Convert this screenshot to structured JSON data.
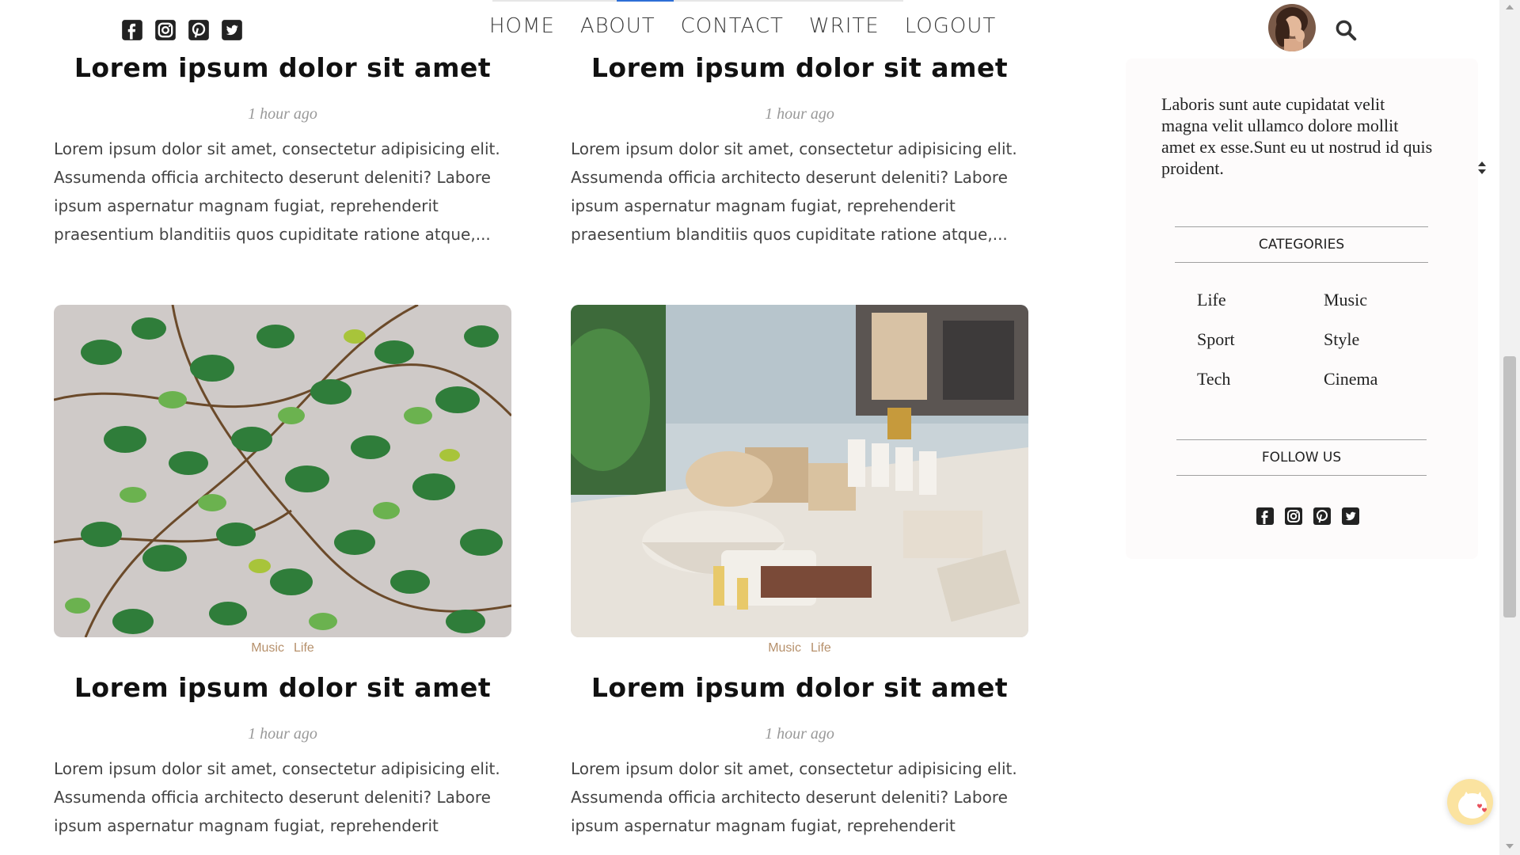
{
  "nav": {
    "links": [
      "HOME",
      "ABOUT",
      "CONTACT",
      "WRITE",
      "LOGOUT"
    ],
    "progress_fraction": 0.14,
    "social_icons": [
      "facebook-icon",
      "instagram-icon",
      "pinterest-icon",
      "twitter-icon"
    ]
  },
  "posts": [
    {
      "title": "Lorem ipsum dolor sit amet",
      "date": "1 hour ago",
      "desc": "Lorem ipsum dolor sit amet, consectetur adipisicing elit. Assumenda officia architecto deserunt deleniti? Labore ipsum aspernatur magnam fugiat, reprehenderit praesentium blanditiis quos cupiditate ratione atque,..."
    },
    {
      "title": "Lorem ipsum dolor sit amet",
      "date": "1 hour ago",
      "desc": "Lorem ipsum dolor sit amet, consectetur adipisicing elit. Assumenda officia architecto deserunt deleniti? Labore ipsum aspernatur magnam fugiat, reprehenderit praesentium blanditiis quos cupiditate ratione atque,..."
    },
    {
      "cats": [
        "Music",
        "Life"
      ],
      "title": "Lorem ipsum dolor sit amet",
      "date": "1 hour ago",
      "desc": "Lorem ipsum dolor sit amet, consectetur adipisicing elit. Assumenda officia architecto deserunt deleniti? Labore ipsum aspernatur magnam fugiat, reprehenderit"
    },
    {
      "cats": [
        "Music",
        "Life"
      ],
      "title": "Lorem ipsum dolor sit amet",
      "date": "1 hour ago",
      "desc": "Lorem ipsum dolor sit amet, consectetur adipisicing elit. Assumenda officia architecto deserunt deleniti? Labore ipsum aspernatur magnam fugiat, reprehenderit"
    }
  ],
  "sidebar": {
    "about_text": "Laboris sunt aute cupidatat velit magna velit ullamco dolore mollit amet ex esse.Sunt eu ut nostrud id quis proident.",
    "categories_title": "CATEGORIES",
    "categories": [
      "Life",
      "Music",
      "Sport",
      "Style",
      "Tech",
      "Cinema"
    ],
    "follow_title": "FOLLOW US"
  },
  "colors": {
    "accent": "#2d6fd6",
    "category_text": "#b6906b",
    "sidebar_bg": "#fdfbfb"
  }
}
